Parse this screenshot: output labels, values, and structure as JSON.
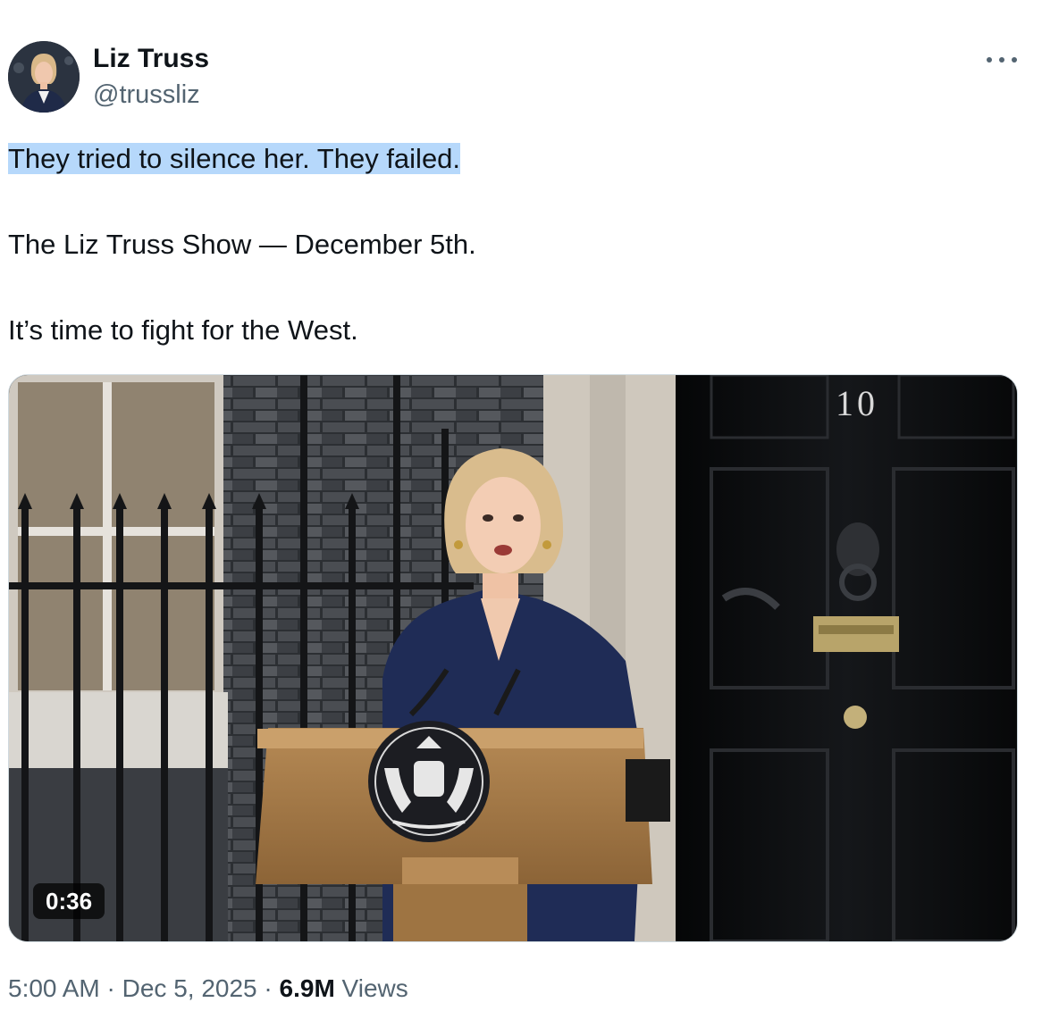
{
  "author": {
    "name": "Liz Truss",
    "handle": "@trussliz"
  },
  "more_icon": "ellipsis-icon",
  "tweet": {
    "line1": "They tried to silence her. They failed.",
    "line2": "The Liz Truss Show — December 5th.",
    "line3": "It’s time to fight for the West."
  },
  "video": {
    "duration": "0:36",
    "door_number": "10"
  },
  "meta": {
    "time": "5:00 AM",
    "separator": "·",
    "date": "Dec 5, 2025",
    "views_count": "6.9M",
    "views_label": "Views"
  },
  "colors": {
    "text": "#0f1419",
    "secondary": "#536471",
    "highlight": "#b6d8fb",
    "border": "#cfd9de"
  }
}
